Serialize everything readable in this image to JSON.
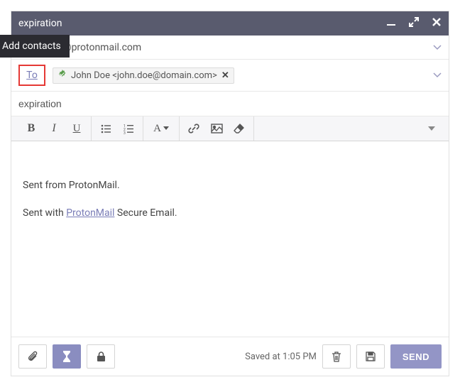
{
  "tooltip": "Add contacts",
  "titlebar": {
    "title": "expiration"
  },
  "from": {
    "domain": "@protonmail.com"
  },
  "to": {
    "label": "To",
    "recipient": "John Doe <john.doe@domain.com>"
  },
  "subject": {
    "value": "expiration"
  },
  "body": {
    "line1": "Sent from ProtonMail.",
    "line2_pre": "Sent with ",
    "line2_link": "ProtonMail",
    "line2_post": " Secure Email."
  },
  "footer": {
    "saved": "Saved at 1:05 PM",
    "send": "SEND"
  }
}
